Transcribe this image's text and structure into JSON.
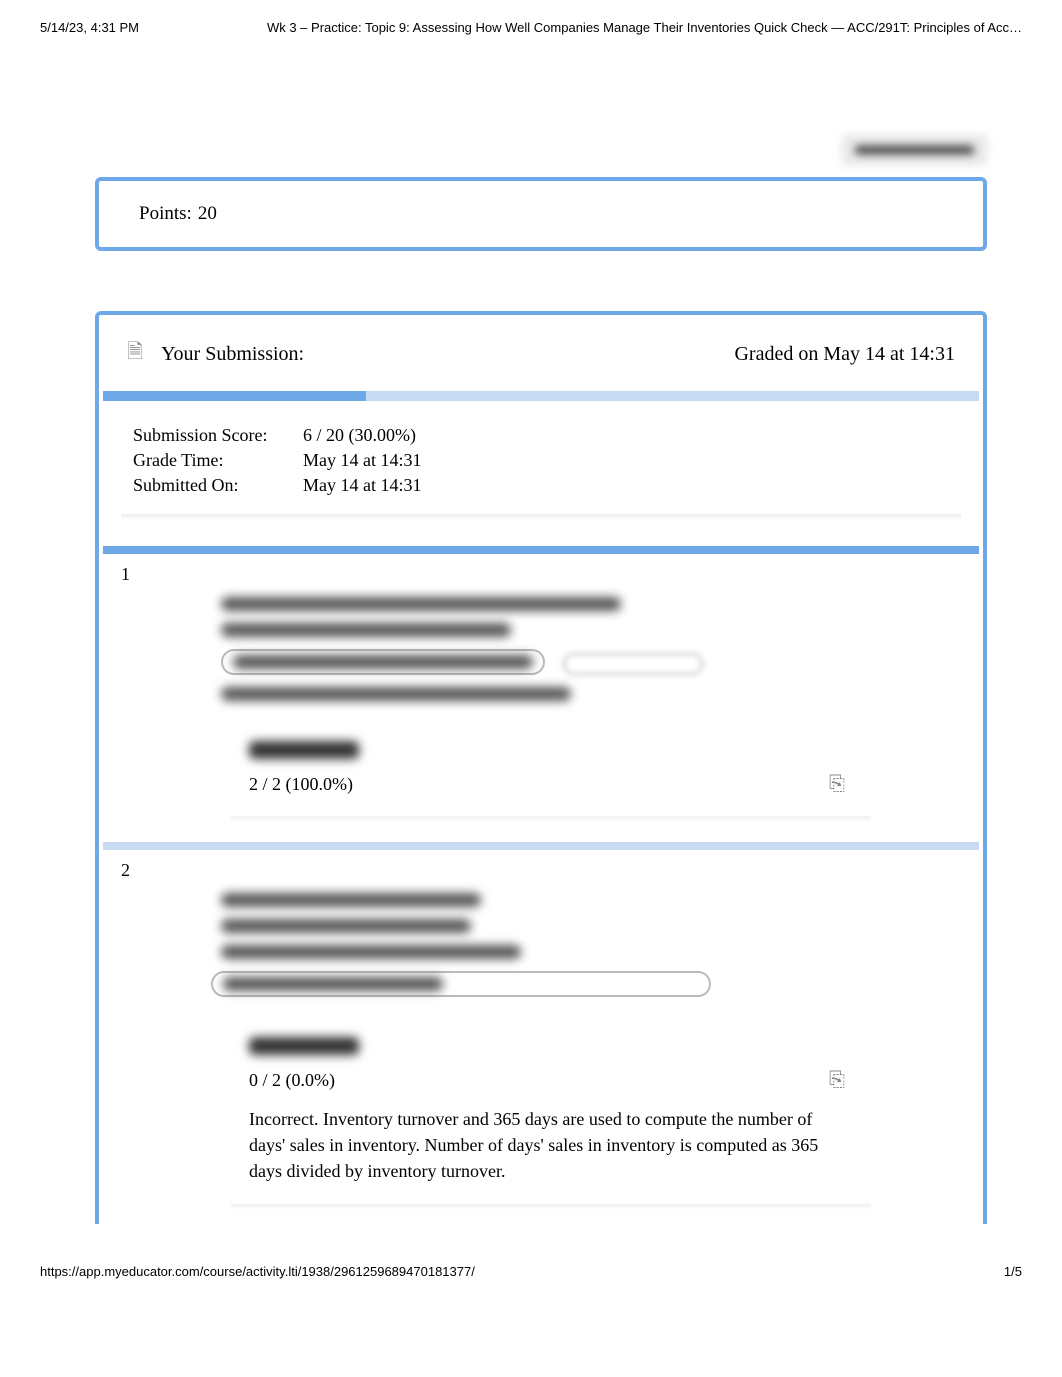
{
  "header": {
    "timestamp": "5/14/23, 4:31 PM",
    "title": "Wk 3 – Practice: Topic 9: Assessing How Well Companies Manage Their Inventories Quick Check — ACC/291T: Principles of Acc…"
  },
  "points": {
    "label": "Points:",
    "value": "20"
  },
  "submission": {
    "heading": "Your Submission:",
    "graded_text": "Graded on May 14 at 14:31",
    "score_label": "Submission Score:",
    "score_value": "6 / 20 (30.00%)",
    "grade_time_label": "Grade Time:",
    "grade_time_value": "May 14 at 14:31",
    "submitted_label": "Submitted On:",
    "submitted_value": "May 14 at 14:31"
  },
  "q1": {
    "number": "1",
    "score": "2 / 2 (100.0%)"
  },
  "q2": {
    "number": "2",
    "score": "0 / 2 (0.0%)",
    "feedback": "Incorrect. Inventory turnover and 365 days are used to compute the number of days' sales in inventory. Number of days' sales in inventory is computed as 365 days divided by inventory turnover."
  },
  "footer": {
    "url": "https://app.myeducator.com/course/activity.lti/1938/2961259689470181377/",
    "page": "1/5"
  }
}
